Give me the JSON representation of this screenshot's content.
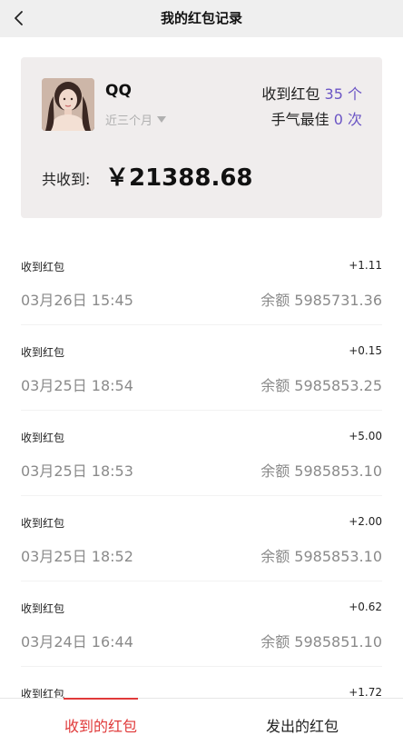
{
  "nav": {
    "title": "我的红包记录",
    "back_icon": "chevron-left-icon"
  },
  "summary": {
    "user_name": "QQ",
    "period_label": "近三个月",
    "received_label": "收到红包",
    "received_count": "35",
    "received_unit": "个",
    "best_label": "手气最佳",
    "best_count": "0",
    "best_unit": "次",
    "total_label": "共收到:",
    "total_amount": "￥21388.68",
    "accent_color": "#6b55c5"
  },
  "records": [
    {
      "title": "收到红包",
      "amount": "+1.11",
      "time": "03月26日 15:45",
      "balance": "余额 5985731.36"
    },
    {
      "title": "收到红包",
      "amount": "+0.15",
      "time": "03月25日 18:54",
      "balance": "余额 5985853.25"
    },
    {
      "title": "收到红包",
      "amount": "+5.00",
      "time": "03月25日 18:53",
      "balance": "余额 5985853.10"
    },
    {
      "title": "收到红包",
      "amount": "+2.00",
      "time": "03月25日 18:52",
      "balance": "余额 5985853.10"
    },
    {
      "title": "收到红包",
      "amount": "+0.62",
      "time": "03月24日 16:44",
      "balance": "余额 5985851.10"
    },
    {
      "title": "收到红包",
      "amount": "+1.72",
      "time": "",
      "balance": ""
    }
  ],
  "tabs": {
    "received_label": "收到的红包",
    "sent_label": "发出的红包",
    "active_color": "#e03a3a"
  }
}
